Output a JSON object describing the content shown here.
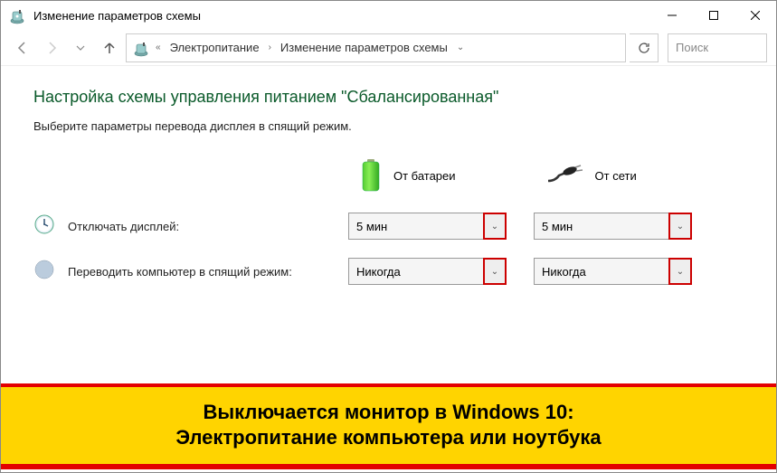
{
  "titlebar": {
    "title": "Изменение параметров схемы"
  },
  "breadcrumb": {
    "seg1": "Электропитание",
    "seg2": "Изменение параметров схемы"
  },
  "search": {
    "placeholder": "Поиск"
  },
  "page": {
    "heading": "Настройка схемы управления питанием \"Сбалансированная\"",
    "subtext": "Выберите параметры перевода дисплея в спящий режим."
  },
  "columns": {
    "battery": "От батареи",
    "plugged": "От сети"
  },
  "rows": {
    "display": {
      "label": "Отключать дисплей:",
      "battery": "5 мин",
      "plugged": "5 мин"
    },
    "sleep": {
      "label": "Переводить компьютер в спящий режим:",
      "battery": "Никогда",
      "plugged": "Никогда"
    }
  },
  "banner": {
    "line1": "Выключается монитор в Windows 10:",
    "line2": "Электропитание компьютера или ноутбука"
  }
}
